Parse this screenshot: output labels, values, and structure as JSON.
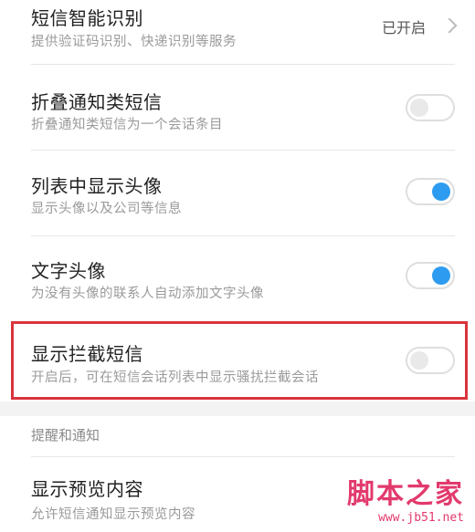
{
  "settings": [
    {
      "title": "短信智能识别",
      "subtitle": "提供验证码识别、快递识别等服务",
      "status": "已开启"
    },
    {
      "title": "折叠通知类短信",
      "subtitle": "折叠通知类短信为一个会话条目",
      "toggle": "off"
    },
    {
      "title": "列表中显示头像",
      "subtitle": "显示头像以及公司等信息",
      "toggle": "on"
    },
    {
      "title": "文字头像",
      "subtitle": "为没有头像的联系人自动添加文字头像",
      "toggle": "on"
    },
    {
      "title": "显示拦截短信",
      "subtitle": "开启后，可在短信会话列表中显示骚扰拦截会话",
      "toggle": "off"
    }
  ],
  "section": {
    "label": "提醒和通知"
  },
  "preview": {
    "title": "显示预览内容",
    "subtitle": "允许短信通知显示预览内容"
  },
  "watermark": {
    "main": "脚本之家",
    "url": "www.jb51.net"
  },
  "colors": {
    "toggle_on": "#2d9bf0",
    "highlight": "#d9343c",
    "watermark": "#e23a6d"
  }
}
